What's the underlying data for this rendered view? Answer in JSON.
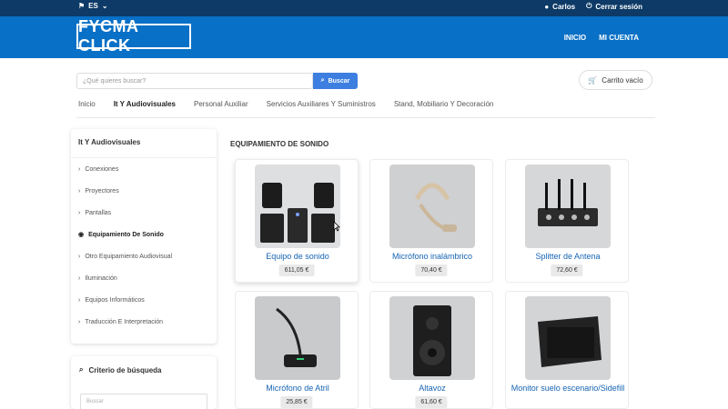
{
  "topbar": {
    "language": "ES",
    "user": "Carlos",
    "logout": "Cerrar sesión",
    "icons": [
      "flag-icon",
      "chevron-down-icon",
      "user-icon",
      "power-icon"
    ]
  },
  "header": {
    "logo": "FYCMA CLICK",
    "nav": [
      "INICIO",
      "MI CUENTA"
    ],
    "colors": {
      "topbar": "#0d3a66",
      "header": "#0870c6",
      "accent": "#3d7fe0",
      "link": "#1664b3"
    }
  },
  "search": {
    "placeholder": "¿Qué quieres buscar?",
    "button": "Buscar"
  },
  "cart": {
    "label": "Carrito vacío"
  },
  "categories": [
    "Inicio",
    "It Y Audiovisuales",
    "Personal Auxiliar",
    "Servicios Auxiliares Y Suministros",
    "Stand, Mobiliario Y Decoración"
  ],
  "sidebar": {
    "title": "It Y Audiovisuales",
    "items": [
      "Conexiones",
      "Proyectores",
      "Pantallas",
      "Equipamiento De Sonido",
      "Otro Equipamiento Audiovisual",
      "Iluminación",
      "Equipos Informáticos",
      "Traducción E Interpretación"
    ]
  },
  "criteria": {
    "title": "Criterio de búsqueda",
    "placeholder": "Buscar"
  },
  "section": {
    "title": "EQUIPAMIENTO DE SONIDO"
  },
  "products": [
    {
      "name": "Equipo de sonido",
      "price": "611,05 €"
    },
    {
      "name": "Micrófono inalámbrico",
      "price": "70,40 €"
    },
    {
      "name": "Splitter de Antena",
      "price": "72,60 €"
    },
    {
      "name": "Micrófono de Atril",
      "price": "25,85 €"
    },
    {
      "name": "Altavoz",
      "price": "61,60 €"
    },
    {
      "name": "Monitor suelo escenario/Sidefill",
      "price": ""
    }
  ]
}
